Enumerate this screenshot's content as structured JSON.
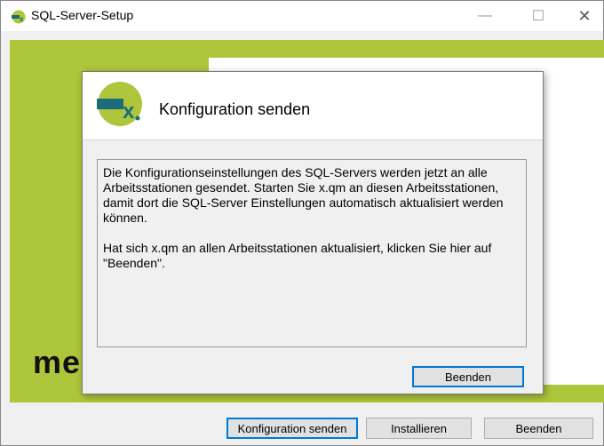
{
  "window": {
    "title": "SQL-Server-Setup",
    "minimize_symbol": "—",
    "maximize_symbol": "☐",
    "close_symbol": "✕"
  },
  "background": {
    "partial_text": "me"
  },
  "dialog": {
    "title": "Konfiguration senden",
    "paragraph1": "Die Konfigurationseinstellungen des SQL-Servers werden jetzt an alle Arbeitsstationen gesendet. Starten Sie x.qm an diesen Arbeitsstationen, damit dort die SQL-Server Einstellungen automatisch aktualisiert werden können.",
    "paragraph2": "Hat sich x.qm an allen Arbeitsstationen aktualisiert, klicken Sie hier auf \"Beenden\".",
    "button_end": "Beenden"
  },
  "buttons": {
    "config": "Konfiguration senden",
    "install": "Installieren",
    "end": "Beenden"
  },
  "colors": {
    "brand_green": "#aec63b",
    "logo_teal": "#1e6b7a",
    "accent_blue": "#0078d7"
  },
  "icons": {
    "app": "xqm-logo-icon",
    "dialog": "xqm-logo-icon"
  }
}
